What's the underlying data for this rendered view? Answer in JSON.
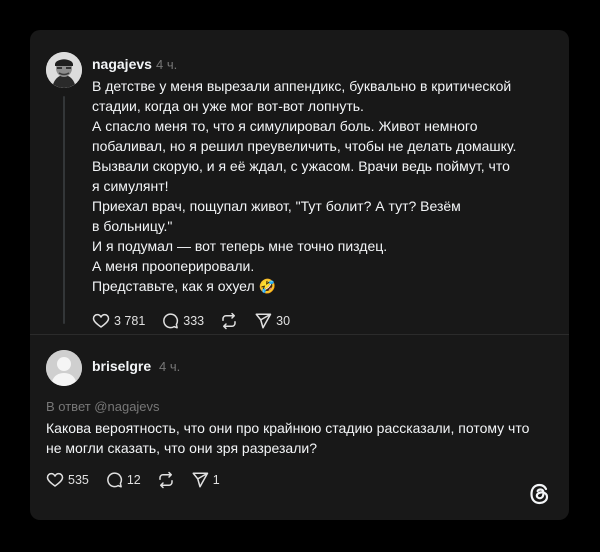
{
  "post": {
    "username": "nagajevs",
    "time": "4 ч.",
    "lines": [
      "В детстве у меня вырезали аппендикс, буквально в критической",
      "стадии, когда он уже мог вот-вот лопнуть.",
      "А спасло меня то, что я симулировал боль. Живот немного",
      "побаливал, но я решил преувеличить, чтобы не делать домашку.",
      "Вызвали скорую, и я её ждал, с ужасом. Врачи ведь поймут, что",
      "я симулянт!",
      "Приехал врач, пощупал живот, \"Тут болит? А тут? Везём",
      "в больницу.\"",
      "И я подумал — вот теперь мне точно пиздец.",
      "А меня прооперировали.",
      "Представьте, как я охуел 🤣"
    ],
    "likes": "3 781",
    "comments": "333",
    "shares": "30"
  },
  "reply": {
    "username": "briselgre",
    "time": "4 ч.",
    "reply_to": "В ответ @nagajevs",
    "lines": [
      "Какова вероятность, что они про крайнюю стадию рассказали, потому что",
      "не могли сказать, что они зря разрезали?"
    ],
    "likes": "535",
    "comments": "12",
    "shares": "1"
  },
  "colors": {
    "background": "#000000",
    "card": "#181818",
    "text": "#f3f5f7",
    "muted": "#777777"
  },
  "icons": [
    "heart-icon",
    "comment-icon",
    "repost-icon",
    "share-icon",
    "threads-logo-icon"
  ]
}
